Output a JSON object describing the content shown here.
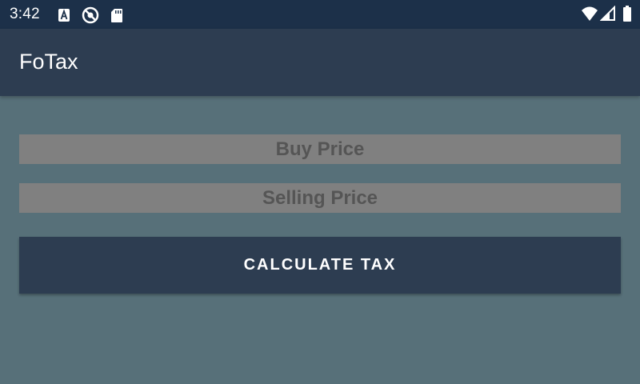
{
  "status_bar": {
    "time": "3:42",
    "left_icons": [
      "a-badge-icon",
      "blocked-location-icon",
      "sd-card-icon"
    ],
    "right_icons": [
      "wifi-icon",
      "signal-icon",
      "battery-icon"
    ]
  },
  "app_bar": {
    "title": "FoTax"
  },
  "form": {
    "buy_price": {
      "value": "",
      "placeholder": "Buy Price"
    },
    "selling_price": {
      "value": "",
      "placeholder": "Selling Price"
    },
    "calculate_label": "CALCULATE TAX"
  },
  "colors": {
    "status_bar": "#1c3049",
    "app_bar": "#2d3d51",
    "background": "#577079",
    "field_bg": "#808080",
    "field_text": "#555555",
    "button_bg": "#2d3d51",
    "button_text": "#ffffff"
  }
}
